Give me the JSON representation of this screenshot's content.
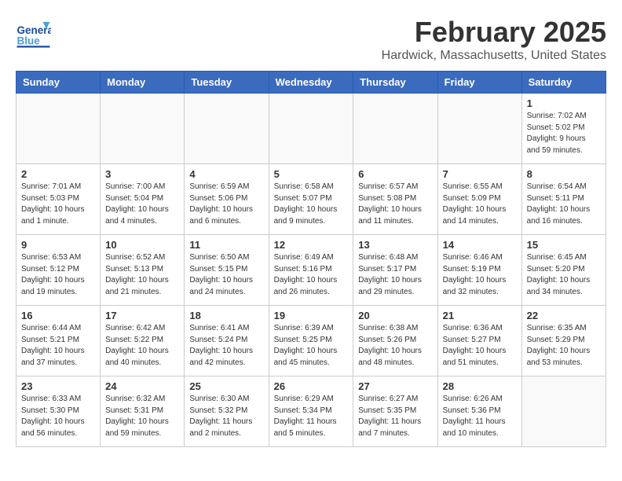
{
  "header": {
    "logo_general": "General",
    "logo_blue": "Blue",
    "title": "February 2025",
    "subtitle": "Hardwick, Massachusetts, United States"
  },
  "days_of_week": [
    "Sunday",
    "Monday",
    "Tuesday",
    "Wednesday",
    "Thursday",
    "Friday",
    "Saturday"
  ],
  "weeks": [
    [
      {
        "day": "",
        "info": ""
      },
      {
        "day": "",
        "info": ""
      },
      {
        "day": "",
        "info": ""
      },
      {
        "day": "",
        "info": ""
      },
      {
        "day": "",
        "info": ""
      },
      {
        "day": "",
        "info": ""
      },
      {
        "day": "1",
        "info": "Sunrise: 7:02 AM\nSunset: 5:02 PM\nDaylight: 9 hours and 59 minutes."
      }
    ],
    [
      {
        "day": "2",
        "info": "Sunrise: 7:01 AM\nSunset: 5:03 PM\nDaylight: 10 hours and 1 minute."
      },
      {
        "day": "3",
        "info": "Sunrise: 7:00 AM\nSunset: 5:04 PM\nDaylight: 10 hours and 4 minutes."
      },
      {
        "day": "4",
        "info": "Sunrise: 6:59 AM\nSunset: 5:06 PM\nDaylight: 10 hours and 6 minutes."
      },
      {
        "day": "5",
        "info": "Sunrise: 6:58 AM\nSunset: 5:07 PM\nDaylight: 10 hours and 9 minutes."
      },
      {
        "day": "6",
        "info": "Sunrise: 6:57 AM\nSunset: 5:08 PM\nDaylight: 10 hours and 11 minutes."
      },
      {
        "day": "7",
        "info": "Sunrise: 6:55 AM\nSunset: 5:09 PM\nDaylight: 10 hours and 14 minutes."
      },
      {
        "day": "8",
        "info": "Sunrise: 6:54 AM\nSunset: 5:11 PM\nDaylight: 10 hours and 16 minutes."
      }
    ],
    [
      {
        "day": "9",
        "info": "Sunrise: 6:53 AM\nSunset: 5:12 PM\nDaylight: 10 hours and 19 minutes."
      },
      {
        "day": "10",
        "info": "Sunrise: 6:52 AM\nSunset: 5:13 PM\nDaylight: 10 hours and 21 minutes."
      },
      {
        "day": "11",
        "info": "Sunrise: 6:50 AM\nSunset: 5:15 PM\nDaylight: 10 hours and 24 minutes."
      },
      {
        "day": "12",
        "info": "Sunrise: 6:49 AM\nSunset: 5:16 PM\nDaylight: 10 hours and 26 minutes."
      },
      {
        "day": "13",
        "info": "Sunrise: 6:48 AM\nSunset: 5:17 PM\nDaylight: 10 hours and 29 minutes."
      },
      {
        "day": "14",
        "info": "Sunrise: 6:46 AM\nSunset: 5:19 PM\nDaylight: 10 hours and 32 minutes."
      },
      {
        "day": "15",
        "info": "Sunrise: 6:45 AM\nSunset: 5:20 PM\nDaylight: 10 hours and 34 minutes."
      }
    ],
    [
      {
        "day": "16",
        "info": "Sunrise: 6:44 AM\nSunset: 5:21 PM\nDaylight: 10 hours and 37 minutes."
      },
      {
        "day": "17",
        "info": "Sunrise: 6:42 AM\nSunset: 5:22 PM\nDaylight: 10 hours and 40 minutes."
      },
      {
        "day": "18",
        "info": "Sunrise: 6:41 AM\nSunset: 5:24 PM\nDaylight: 10 hours and 42 minutes."
      },
      {
        "day": "19",
        "info": "Sunrise: 6:39 AM\nSunset: 5:25 PM\nDaylight: 10 hours and 45 minutes."
      },
      {
        "day": "20",
        "info": "Sunrise: 6:38 AM\nSunset: 5:26 PM\nDaylight: 10 hours and 48 minutes."
      },
      {
        "day": "21",
        "info": "Sunrise: 6:36 AM\nSunset: 5:27 PM\nDaylight: 10 hours and 51 minutes."
      },
      {
        "day": "22",
        "info": "Sunrise: 6:35 AM\nSunset: 5:29 PM\nDaylight: 10 hours and 53 minutes."
      }
    ],
    [
      {
        "day": "23",
        "info": "Sunrise: 6:33 AM\nSunset: 5:30 PM\nDaylight: 10 hours and 56 minutes."
      },
      {
        "day": "24",
        "info": "Sunrise: 6:32 AM\nSunset: 5:31 PM\nDaylight: 10 hours and 59 minutes."
      },
      {
        "day": "25",
        "info": "Sunrise: 6:30 AM\nSunset: 5:32 PM\nDaylight: 11 hours and 2 minutes."
      },
      {
        "day": "26",
        "info": "Sunrise: 6:29 AM\nSunset: 5:34 PM\nDaylight: 11 hours and 5 minutes."
      },
      {
        "day": "27",
        "info": "Sunrise: 6:27 AM\nSunset: 5:35 PM\nDaylight: 11 hours and 7 minutes."
      },
      {
        "day": "28",
        "info": "Sunrise: 6:26 AM\nSunset: 5:36 PM\nDaylight: 11 hours and 10 minutes."
      },
      {
        "day": "",
        "info": ""
      }
    ]
  ]
}
